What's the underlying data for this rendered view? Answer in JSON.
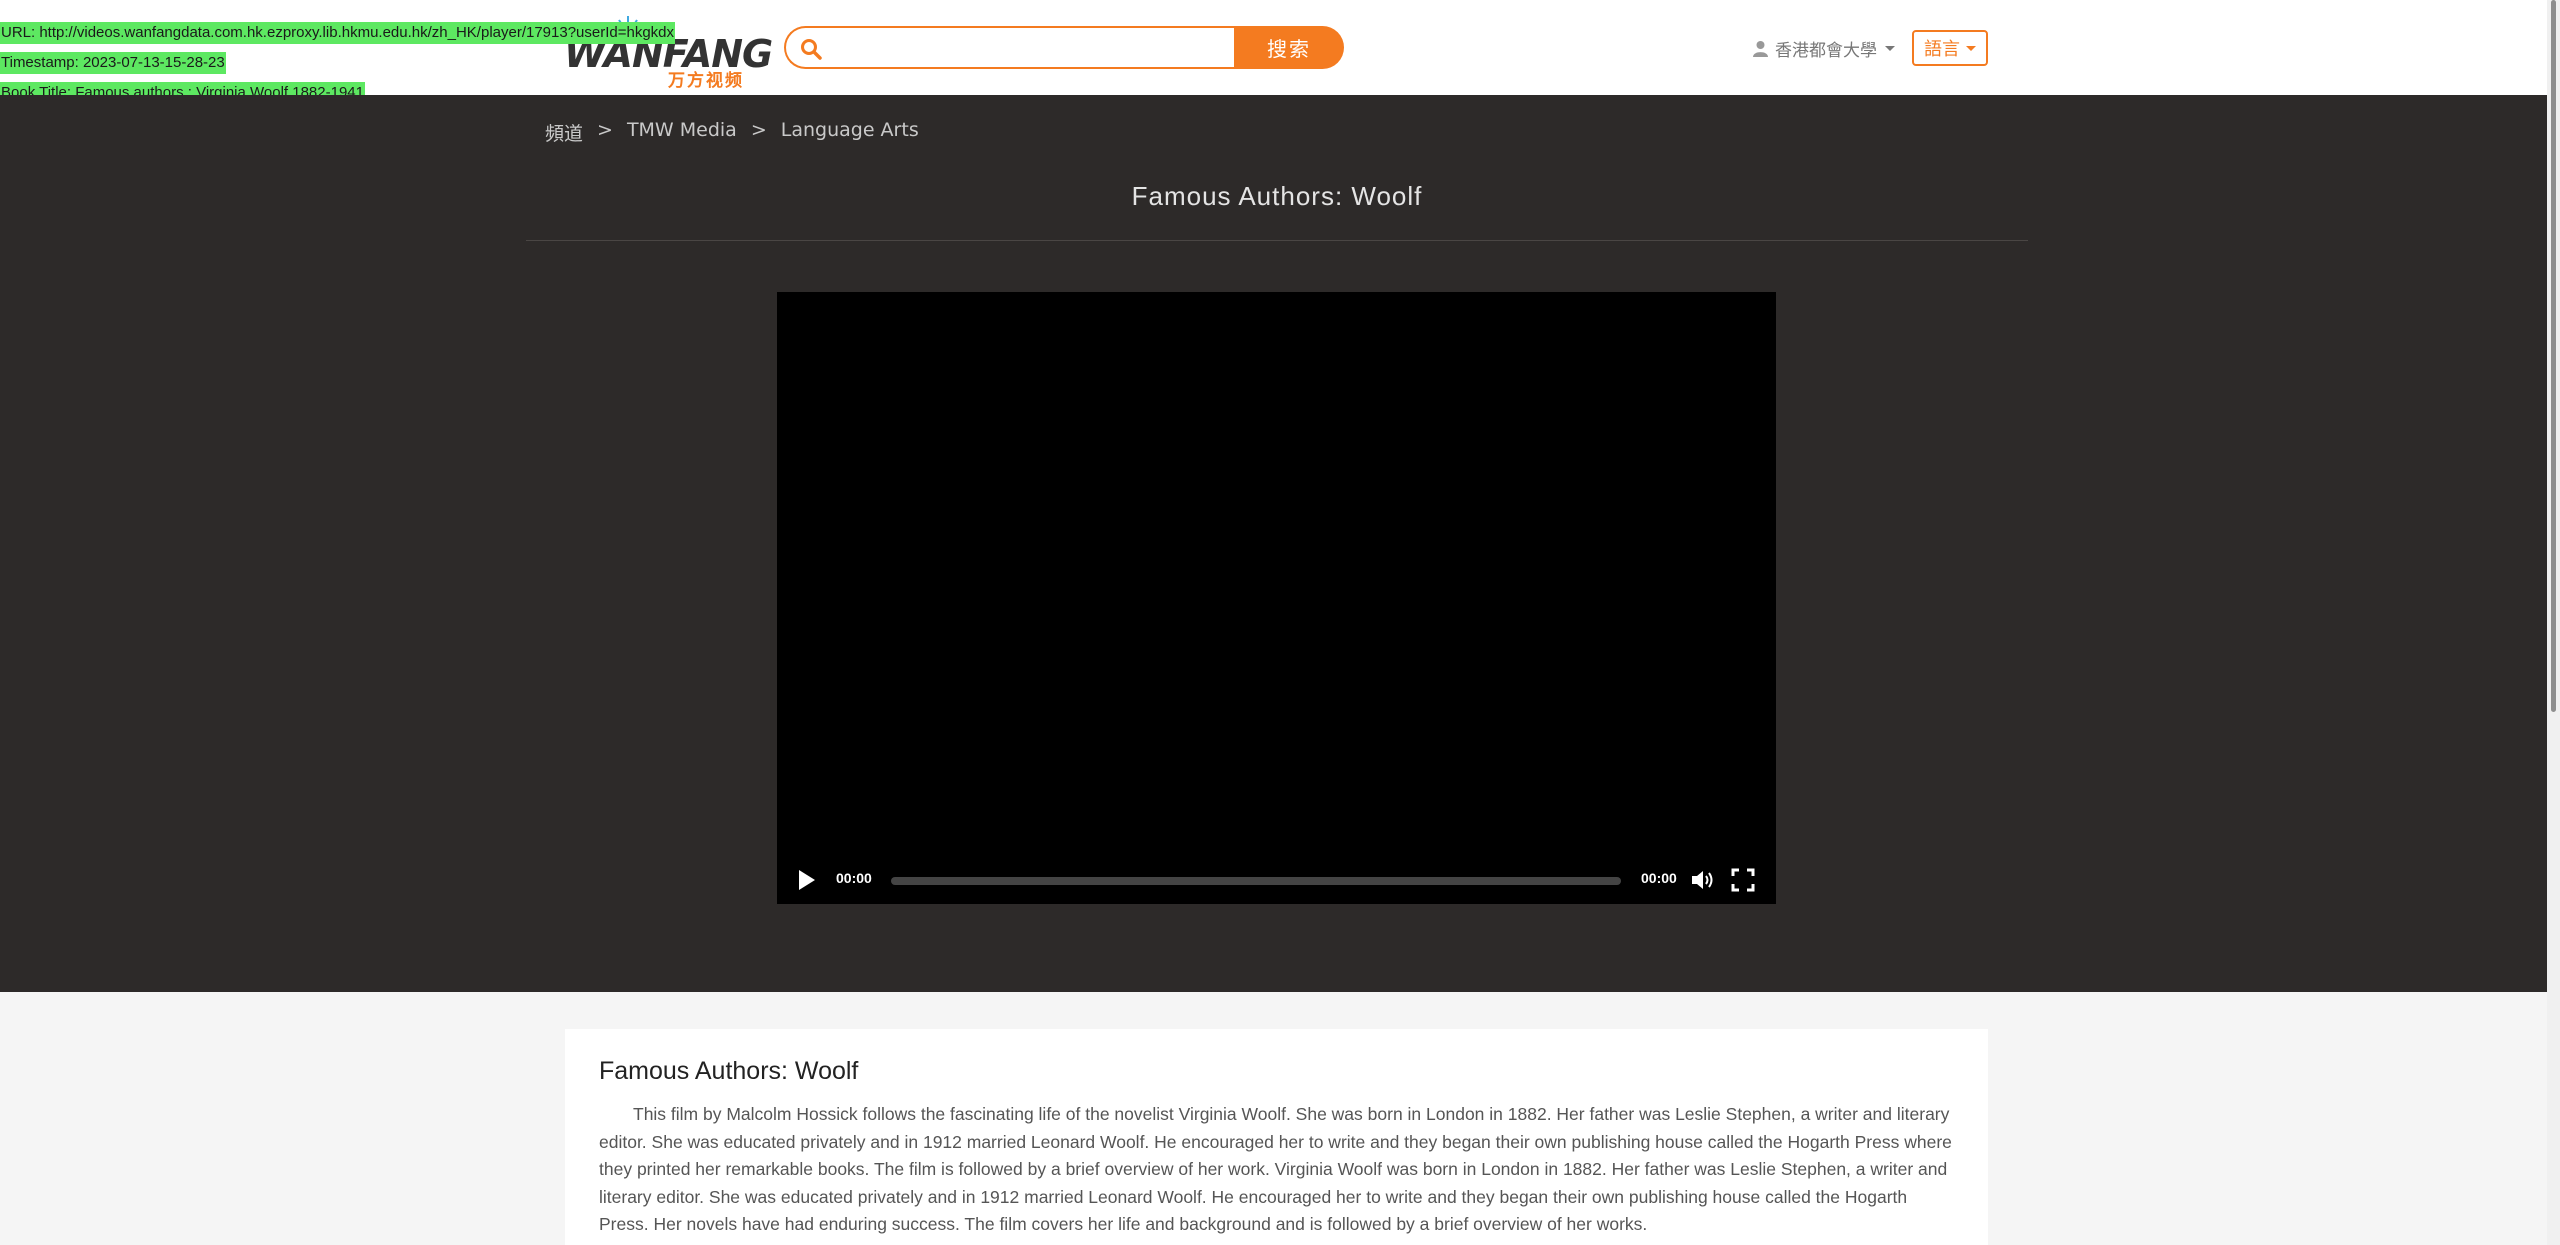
{
  "header": {
    "logo_main": "WANFANG",
    "logo_sub": "万方视频",
    "search": {
      "placeholder": "",
      "value": "",
      "button_label": "搜索"
    },
    "user_label": "香港都會大學",
    "language_label": "語言"
  },
  "overlay": {
    "url": "URL: http://videos.wanfangdata.com.hk.ezproxy.lib.hkmu.edu.hk/zh_HK/player/17913?userId=hkgkdx",
    "timestamp": "Timestamp: 2023-07-13-15-28-23",
    "book_title": "Book Title: Famous authors : Virginia Woolf 1882-1941",
    "highlight_color": "#5de861"
  },
  "breadcrumb": {
    "items": [
      "頻道",
      "TMW Media",
      "Language Arts"
    ],
    "separator": ">"
  },
  "video": {
    "title": "Famous Authors: Woolf",
    "current_time": "00:00",
    "duration": "00:00",
    "progress": 0
  },
  "description": {
    "title": "Famous Authors: Woolf",
    "body": "This film by Malcolm Hossick follows the fascinating life of the novelist Virginia Woolf. She was born in London in 1882. Her father was Leslie Stephen, a writer and literary editor. She was educated privately and in 1912 married Leonard Woolf. He encouraged her to write and they began their own publishing house called the Hogarth Press where they printed her remarkable books. The film is followed by a brief overview of her work. Virginia Woolf was born in London in 1882. Her father was Leslie Stephen, a writer and literary editor. She was educated privately and in 1912 married Leonard Woolf. He encouraged her to write and they began their own publishing house called the Hogarth Press. Her novels have had enduring success. The film covers her life and background and is followed by a brief overview of her works."
  },
  "colors": {
    "accent": "#f47b20",
    "stage_bg": "#2d2a29",
    "page_bg": "#f5f5f5"
  },
  "icons": [
    "search-icon",
    "user-icon",
    "caret-down-icon",
    "play-icon",
    "volume-icon",
    "fullscreen-icon",
    "logo-spark-icon"
  ]
}
